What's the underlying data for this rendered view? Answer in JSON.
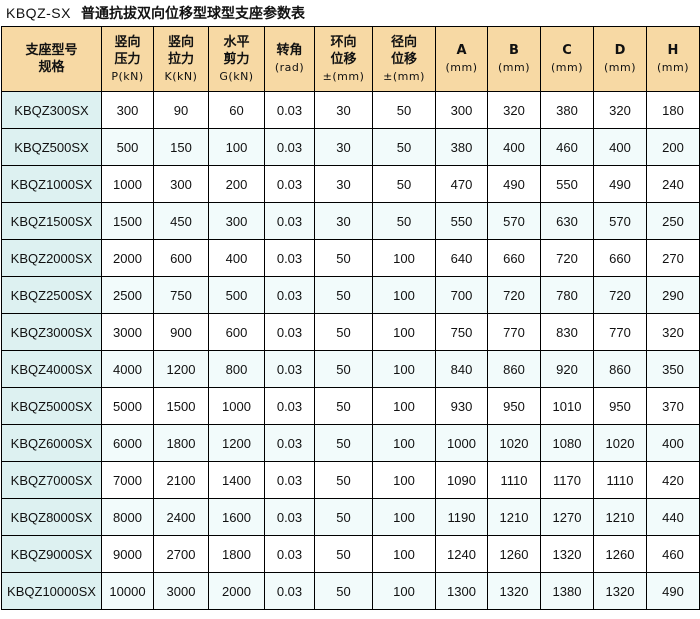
{
  "title": {
    "code": "KBQZ-SX",
    "text": "普通抗拔双向位移型球型支座参数表"
  },
  "table": {
    "headers": [
      {
        "line1": "支座型号",
        "line2": "规格",
        "unit": ""
      },
      {
        "line1": "竖向",
        "line2": "压力",
        "unit": "P(kN)"
      },
      {
        "line1": "竖向",
        "line2": "拉力",
        "unit": "K(kN)"
      },
      {
        "line1": "水平",
        "line2": "剪力",
        "unit": "G(kN)"
      },
      {
        "line1": "转角",
        "line2": "",
        "unit": "(rad)"
      },
      {
        "line1": "环向",
        "line2": "位移",
        "unit": "±(mm)"
      },
      {
        "line1": "径向",
        "line2": "位移",
        "unit": "±(mm)"
      },
      {
        "line1": "A",
        "line2": "",
        "unit": "(mm)"
      },
      {
        "line1": "B",
        "line2": "",
        "unit": "(mm)"
      },
      {
        "line1": "C",
        "line2": "",
        "unit": "(mm)"
      },
      {
        "line1": "D",
        "line2": "",
        "unit": "(mm)"
      },
      {
        "line1": "H",
        "line2": "",
        "unit": "(mm)"
      }
    ],
    "rows": [
      [
        "KBQZ300SX",
        "300",
        "90",
        "60",
        "0.03",
        "30",
        "50",
        "300",
        "320",
        "380",
        "320",
        "180"
      ],
      [
        "KBQZ500SX",
        "500",
        "150",
        "100",
        "0.03",
        "30",
        "50",
        "380",
        "400",
        "460",
        "400",
        "200"
      ],
      [
        "KBQZ1000SX",
        "1000",
        "300",
        "200",
        "0.03",
        "30",
        "50",
        "470",
        "490",
        "550",
        "490",
        "240"
      ],
      [
        "KBQZ1500SX",
        "1500",
        "450",
        "300",
        "0.03",
        "30",
        "50",
        "550",
        "570",
        "630",
        "570",
        "250"
      ],
      [
        "KBQZ2000SX",
        "2000",
        "600",
        "400",
        "0.03",
        "50",
        "100",
        "640",
        "660",
        "720",
        "660",
        "270"
      ],
      [
        "KBQZ2500SX",
        "2500",
        "750",
        "500",
        "0.03",
        "50",
        "100",
        "700",
        "720",
        "780",
        "720",
        "290"
      ],
      [
        "KBQZ3000SX",
        "3000",
        "900",
        "600",
        "0.03",
        "50",
        "100",
        "750",
        "770",
        "830",
        "770",
        "320"
      ],
      [
        "KBQZ4000SX",
        "4000",
        "1200",
        "800",
        "0.03",
        "50",
        "100",
        "840",
        "860",
        "920",
        "860",
        "350"
      ],
      [
        "KBQZ5000SX",
        "5000",
        "1500",
        "1000",
        "0.03",
        "50",
        "100",
        "930",
        "950",
        "1010",
        "950",
        "370"
      ],
      [
        "KBQZ6000SX",
        "6000",
        "1800",
        "1200",
        "0.03",
        "50",
        "100",
        "1000",
        "1020",
        "1080",
        "1020",
        "400"
      ],
      [
        "KBQZ7000SX",
        "7000",
        "2100",
        "1400",
        "0.03",
        "50",
        "100",
        "1090",
        "1110",
        "1170",
        "1110",
        "420"
      ],
      [
        "KBQZ8000SX",
        "8000",
        "2400",
        "1600",
        "0.03",
        "50",
        "100",
        "1190",
        "1210",
        "1270",
        "1210",
        "440"
      ],
      [
        "KBQZ9000SX",
        "9000",
        "2700",
        "1800",
        "0.03",
        "50",
        "100",
        "1240",
        "1260",
        "1320",
        "1260",
        "460"
      ],
      [
        "KBQZ10000SX",
        "10000",
        "3000",
        "2000",
        "0.03",
        "50",
        "100",
        "1300",
        "1320",
        "1380",
        "1320",
        "490"
      ]
    ]
  },
  "colors": {
    "header_bg": "#f7d9a4",
    "model_col_bg": "#ddf1f1",
    "stripe_bg": "#f2fbfb",
    "border": "#000000"
  }
}
